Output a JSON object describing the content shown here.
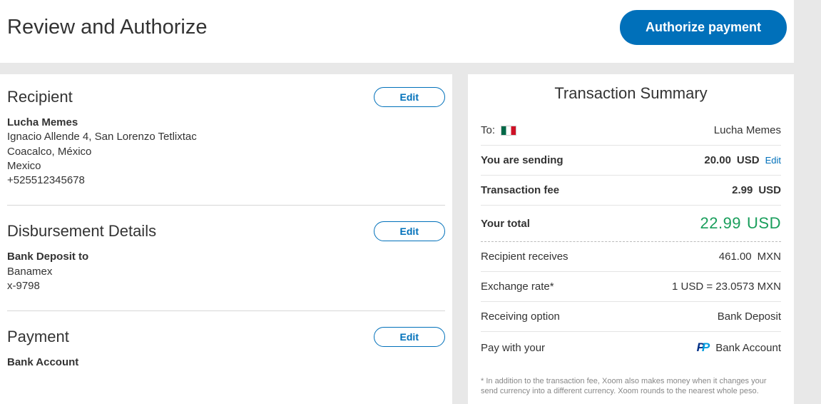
{
  "header": {
    "title": "Review and Authorize",
    "authorize_label": "Authorize payment"
  },
  "recipient": {
    "title": "Recipient",
    "edit_label": "Edit",
    "name": "Lucha Memes",
    "address_line1": "Ignacio Allende 4, San Lorenzo Tetlixtac",
    "address_line2": "Coacalco, México",
    "country": "Mexico",
    "phone": "+525512345678"
  },
  "disbursement": {
    "title": "Disbursement Details",
    "edit_label": "Edit",
    "method_label": "Bank Deposit to",
    "bank_name": "Banamex",
    "account_mask": "x-9798"
  },
  "payment": {
    "title": "Payment",
    "edit_label": "Edit",
    "method": "Bank Account"
  },
  "summary": {
    "title": "Transaction Summary",
    "to_label": "To:",
    "to_flag": "mexico-flag",
    "to_name": "Lucha Memes",
    "sending_label": "You are sending",
    "sending_amount": "20.00",
    "sending_currency": "USD",
    "sending_edit": "Edit",
    "fee_label": "Transaction fee",
    "fee_amount": "2.99",
    "fee_currency": "USD",
    "total_label": "Your total",
    "total_amount": "22.99",
    "total_currency": "USD",
    "receives_label": "Recipient receives",
    "receives_amount": "461.00",
    "receives_currency": "MXN",
    "rate_label": "Exchange rate*",
    "rate_value": "1 USD = 23.0573 MXN",
    "option_label": "Receiving option",
    "option_value": "Bank Deposit",
    "paywith_label": "Pay with your",
    "paywith_value": "Bank Account",
    "disclaimer": "*  In addition to the transaction fee, Xoom also makes money when it changes your send currency into a different currency. Xoom rounds to the nearest whole peso."
  }
}
